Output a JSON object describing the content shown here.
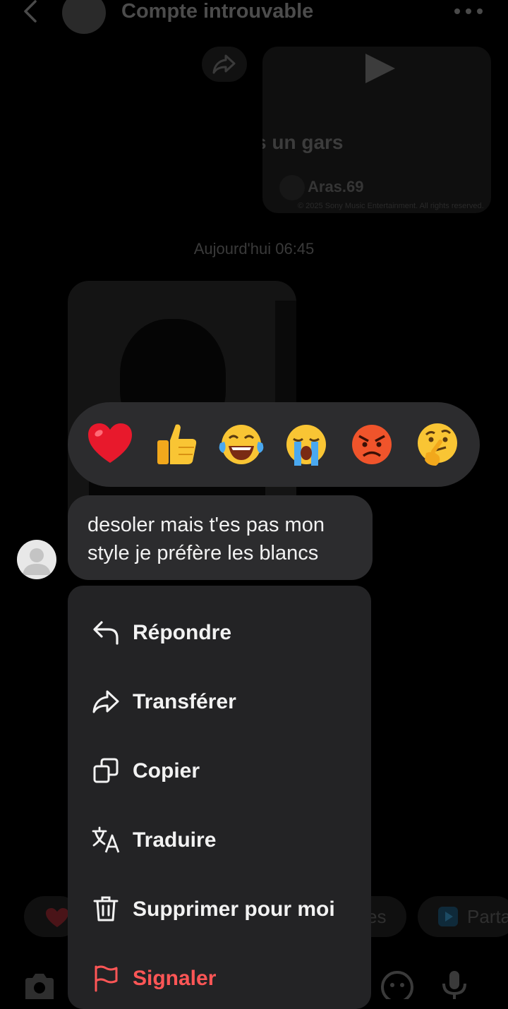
{
  "header": {
    "title": "Compte introuvable"
  },
  "shared_video": {
    "caption": "s un gars",
    "author": "Aras.69",
    "rights": "© 2025 Sony Music Entertainment. All rights reserved."
  },
  "timestamp": "Aujourd'hui 06:45",
  "reactions": [
    "red-heart",
    "thumbs-up",
    "face-with-tears-of-joy",
    "loudly-crying-face",
    "angry-face",
    "thinking-face"
  ],
  "message": {
    "text": "desoler mais t'es pas mon style je préfère les blancs"
  },
  "context_menu": {
    "items": [
      {
        "label": "Répondre",
        "icon": "reply-icon"
      },
      {
        "label": "Transférer",
        "icon": "forward-icon"
      },
      {
        "label": "Copier",
        "icon": "copy-icon"
      },
      {
        "label": "Traduire",
        "icon": "translate-icon"
      },
      {
        "label": "Supprimer pour moi",
        "icon": "trash-icon"
      },
      {
        "label": "Signaler",
        "icon": "flag-icon"
      }
    ]
  },
  "bottom_chips": {
    "left_label": "es",
    "right_label": "Parta"
  },
  "colors": {
    "overlay_surface": "#2c2c2e",
    "menu_surface": "#232325",
    "danger": "#ff5656"
  }
}
